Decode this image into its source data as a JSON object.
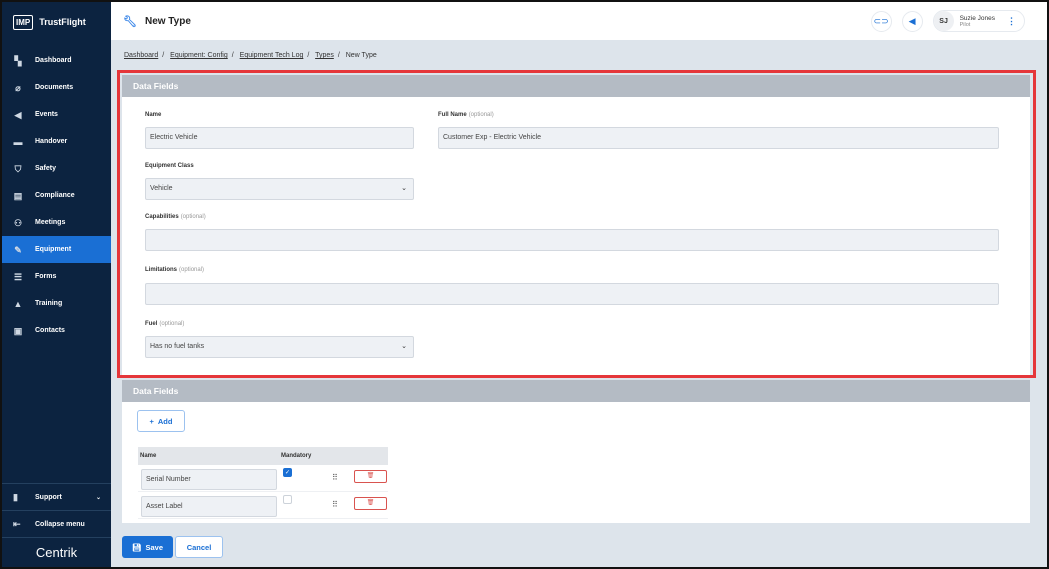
{
  "brand": {
    "logo": "IMP",
    "name": "TrustFlight",
    "footer_logo": "Centrik"
  },
  "sidebar": {
    "items": [
      {
        "label": "Dashboard",
        "icon": "dashboard-icon",
        "glyph": "▚"
      },
      {
        "label": "Documents",
        "icon": "paperclip-icon",
        "glyph": "⌀"
      },
      {
        "label": "Events",
        "icon": "megaphone-icon",
        "glyph": "◀"
      },
      {
        "label": "Handover",
        "icon": "handover-icon",
        "glyph": "▬"
      },
      {
        "label": "Safety",
        "icon": "shield-icon",
        "glyph": "⛉"
      },
      {
        "label": "Compliance",
        "icon": "compliance-icon",
        "glyph": "▤"
      },
      {
        "label": "Meetings",
        "icon": "meetings-icon",
        "glyph": "⚇"
      },
      {
        "label": "Equipment",
        "icon": "wrench-icon",
        "glyph": "✎"
      },
      {
        "label": "Forms",
        "icon": "forms-icon",
        "glyph": "☰"
      },
      {
        "label": "Training",
        "icon": "graduation-cap-icon",
        "glyph": "▲"
      },
      {
        "label": "Contacts",
        "icon": "contacts-icon",
        "glyph": "▣"
      }
    ],
    "active": "Equipment",
    "support": "Support",
    "collapse": "Collapse menu"
  },
  "header": {
    "title": "New Type",
    "user_initials": "SJ",
    "user_name": "Suzie Jones",
    "user_role": "Pilot"
  },
  "breadcrumb": [
    "Dashboard",
    "Equipment: Config",
    "Equipment Tech Log",
    "Types",
    "New Type"
  ],
  "form": {
    "section_title": "Data Fields",
    "optional": "(optional)",
    "name_label": "Name",
    "name_value": "Electric Vehicle",
    "full_name_label": "Full Name",
    "full_name_value": "Customer Exp - Electric Vehicle",
    "class_label": "Equipment Class",
    "class_value": "Vehicle",
    "capabilities_label": "Capabilities",
    "capabilities_value": "",
    "limitations_label": "Limitations",
    "limitations_value": "",
    "fuel_label": "Fuel",
    "fuel_value": "Has no fuel tanks"
  },
  "fields": {
    "section_title": "Data Fields",
    "add_label": "Add",
    "col_name": "Name",
    "col_mandatory": "Mandatory",
    "rows": [
      {
        "name": "Serial Number",
        "mandatory": true
      },
      {
        "name": "Asset Label",
        "mandatory": false
      }
    ]
  },
  "actions": {
    "save": "Save",
    "cancel": "Cancel"
  },
  "colors": {
    "accent": "#1a6fd4",
    "sidebar": "#0c2340",
    "highlight": "#e5363a"
  }
}
